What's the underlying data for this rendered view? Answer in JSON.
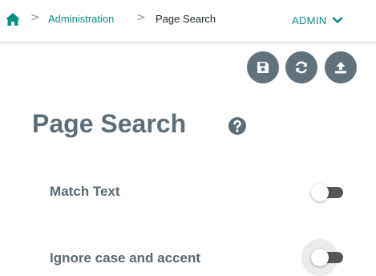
{
  "breadcrumb": {
    "home_icon": "home-icon",
    "separator": ">",
    "link_label": "Administration",
    "current_label": "Page Search"
  },
  "user_menu": {
    "label": "ADMIN",
    "chevron_icon": "chevron-down-icon"
  },
  "toolbar": {
    "buttons": [
      {
        "icon": "save-icon"
      },
      {
        "icon": "refresh-icon"
      },
      {
        "icon": "upload-icon"
      }
    ]
  },
  "page": {
    "title": "Page Search",
    "help_icon": "question-circle-icon"
  },
  "options": [
    {
      "label": "Match Text",
      "enabled": false
    },
    {
      "label": "Ignore case and accent",
      "enabled": false,
      "focused": true
    }
  ],
  "colors": {
    "accent": "#0a8f86",
    "button_bg": "#62727c",
    "title_text": "#5e6e78",
    "toggle_track_off": "#565656"
  }
}
